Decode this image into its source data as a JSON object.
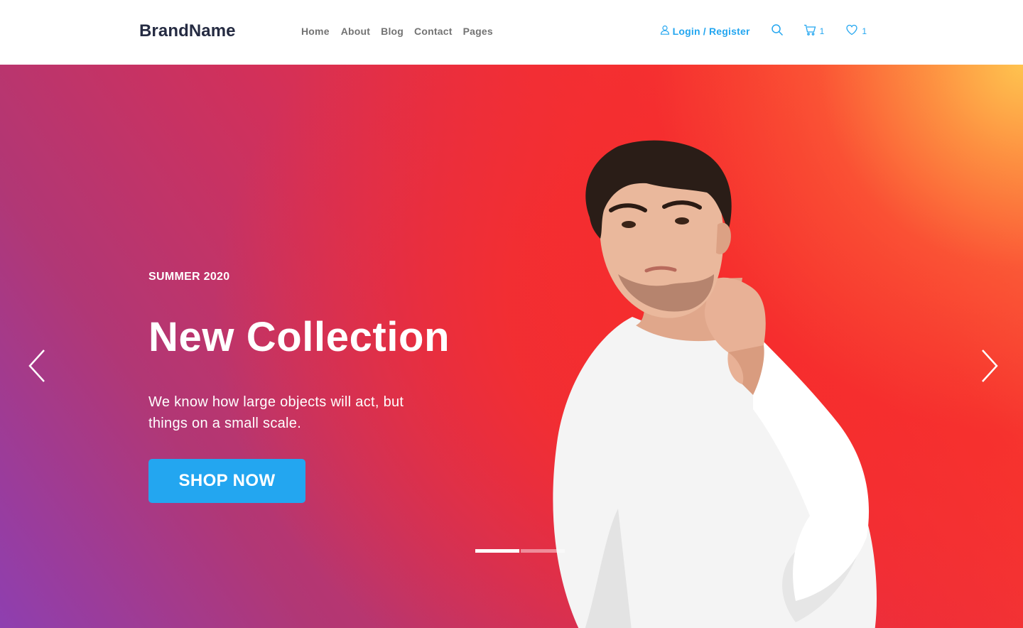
{
  "header": {
    "brand": "BrandName",
    "nav": [
      "Home",
      "About",
      "Blog",
      "Contact",
      "Pages"
    ],
    "login_label": "Login / Register",
    "cart_count": "1",
    "wishlist_count": "1",
    "icons": {
      "user": "user-icon",
      "search": "search-icon",
      "cart": "cart-icon",
      "wishlist": "heart-icon"
    }
  },
  "hero": {
    "season": "SUMMER 2020",
    "headline": "New Collection",
    "description": "We know how large objects will act, but things on a small scale.",
    "cta_label": "SHOP NOW",
    "slides_total": 2,
    "active_slide": 1
  },
  "colors": {
    "brand_text": "#252b42",
    "nav_text": "#737373",
    "accent": "#23a6f0",
    "hero_gradient": [
      "#8e3fb0",
      "#d2305a",
      "#f7352e",
      "#fcc45a"
    ]
  }
}
